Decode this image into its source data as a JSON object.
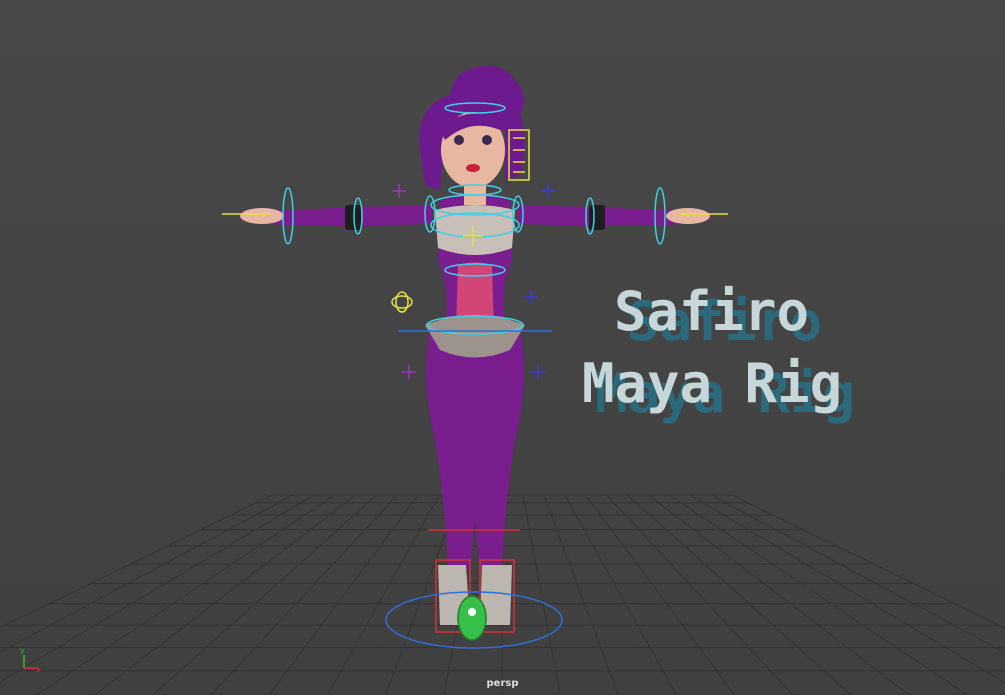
{
  "viewport": {
    "camera": "persp",
    "background_color": "#454545",
    "grid_color": "#2e2e2e"
  },
  "overlay_title": {
    "line1": "Safiro",
    "line2": "Maya Rig",
    "text_color": "#c7d6d8",
    "shadow_color": "#2b6a7c"
  },
  "character": {
    "body_color": "#7a1d8f",
    "skin_color": "#e7b7a2",
    "hair_color": "#6e1a8f",
    "accent_color": "#d24577",
    "top_color": "#c8c0b8"
  },
  "axis_gizmo": {
    "x_label": "x",
    "y_label": "y",
    "x_color": "#e03030",
    "y_color": "#30c030"
  },
  "controls": {
    "fk_ring_color": "#3fd0e8",
    "ik_color": "#e8e040",
    "cross_color_a": "#9a35c8",
    "cross_color_b": "#3a3ad8",
    "root_ring_color": "#2f6fd8",
    "foot_box_color": "#d83030",
    "root_ctrl_color": "#36c04a"
  }
}
